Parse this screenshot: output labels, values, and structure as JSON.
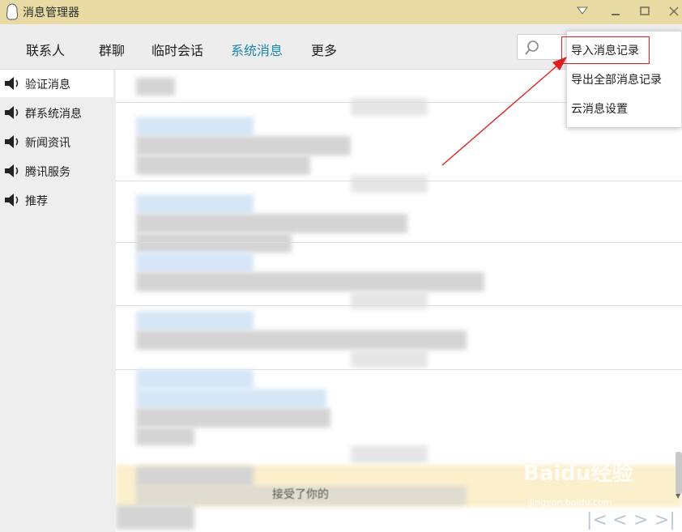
{
  "window": {
    "title": "消息管理器"
  },
  "tabs": [
    {
      "label": "联系人"
    },
    {
      "label": "群聊"
    },
    {
      "label": "临时会话"
    },
    {
      "label": "系统消息"
    },
    {
      "label": "更多"
    }
  ],
  "search": {
    "placeholder": ""
  },
  "sidebar": {
    "items": [
      {
        "label": "验证消息"
      },
      {
        "label": "群系统消息"
      },
      {
        "label": "新闻资讯"
      },
      {
        "label": "腾讯服务"
      },
      {
        "label": "推荐"
      }
    ]
  },
  "dropdown": {
    "items": [
      {
        "label": "导入消息记录"
      },
      {
        "label": "导出全部消息记录"
      },
      {
        "label": "云消息设置"
      }
    ]
  },
  "content": {
    "fragment": "接受了你的"
  },
  "watermark": {
    "brand": "Baidu经验",
    "url": "jingyan.baidu.com"
  },
  "colors": {
    "titlebar": "#e7dba3",
    "active_tab": "#1c86b0",
    "highlight": "#e02020"
  },
  "icons": [
    "qq-penguin-icon",
    "dropdown-triangle-icon",
    "minimize-icon",
    "maximize-icon",
    "close-icon",
    "search-icon",
    "speaker-icon"
  ]
}
